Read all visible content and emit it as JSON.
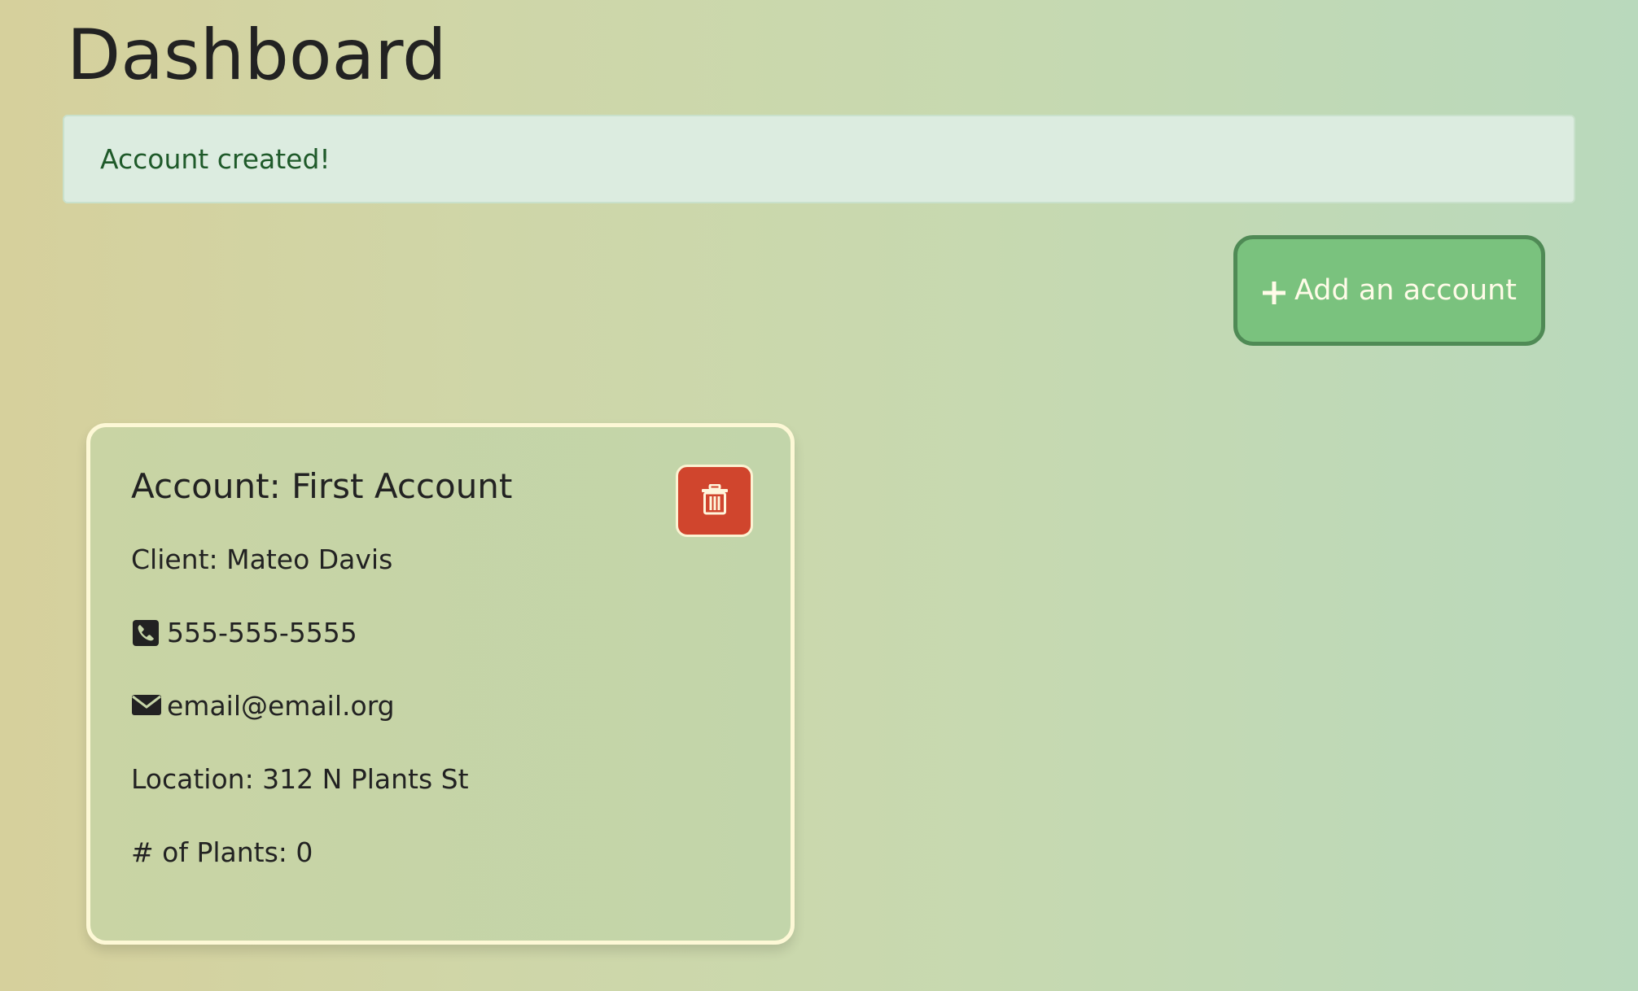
{
  "header": {
    "title": "Dashboard"
  },
  "alert": {
    "message": "Account created!"
  },
  "actions": {
    "add_account_label": "Add an account",
    "add_icon": "plus-icon"
  },
  "account_card": {
    "title": "Account: First Account",
    "client": "Client: Mateo Davis",
    "phone": "555-555-5555",
    "phone_icon": "phone-icon",
    "email": "email@email.org",
    "email_icon": "envelope-icon",
    "location": "Location: 312 N Plants St",
    "plants": "# of Plants: 0",
    "delete_icon": "trash-icon"
  },
  "colors": {
    "accent_green": "#7ac27e",
    "danger_red": "#d0452d",
    "alert_bg": "#dcece0",
    "alert_text": "#1f5a2a"
  }
}
